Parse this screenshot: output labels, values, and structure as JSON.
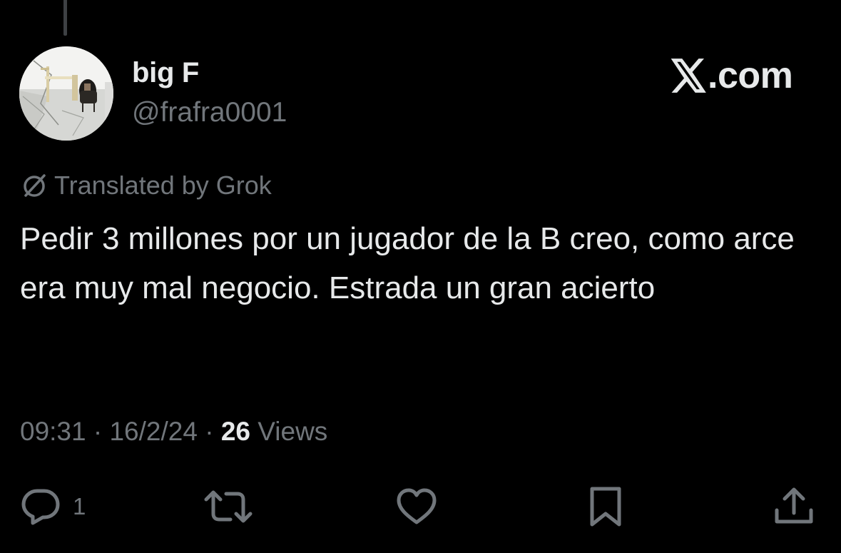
{
  "tweet": {
    "author": {
      "display_name": "big F",
      "handle": "@frafra0001",
      "avatar_icon": "avatar-photo"
    },
    "brand": {
      "text": ".com",
      "logo_icon": "x-logo-icon"
    },
    "translation": {
      "label": "Translated by Grok",
      "icon": "grok-icon"
    },
    "body": "Pedir 3 millones por un jugador de la B creo, como arce era muy mal negocio. Estrada un gran acierto",
    "meta": {
      "time": "09:31",
      "separator": " · ",
      "date": "16/2/24",
      "views_count": "26",
      "views_label": " Views"
    },
    "actions": {
      "reply": {
        "icon": "reply-icon",
        "count": "1"
      },
      "retweet": {
        "icon": "retweet-icon"
      },
      "like": {
        "icon": "heart-icon"
      },
      "bookmark": {
        "icon": "bookmark-icon"
      },
      "share": {
        "icon": "share-icon"
      }
    }
  },
  "colors": {
    "background": "#000000",
    "primary_text": "#e7e9ea",
    "secondary_text": "#71767b",
    "thread_line": "#3e4144"
  }
}
